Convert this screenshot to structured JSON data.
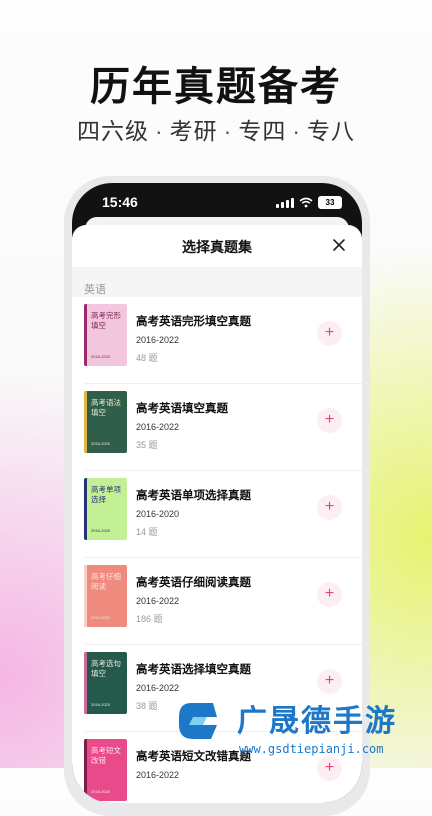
{
  "promo": {
    "headline": "历年真题备考",
    "subtitle_items": [
      "四六级",
      "考研",
      "专四",
      "专八"
    ],
    "separator": "·"
  },
  "phone": {
    "status_time": "15:46",
    "battery": "33",
    "sheet": {
      "title": "选择真题集",
      "section_label": "英语",
      "items": [
        {
          "name": "高考英语完形填空真题",
          "years": "2016-2022",
          "count": "48 题",
          "cover_title": "高考完形填空",
          "cover_year": "2016-2020",
          "cover_bg": "#f2c7dd",
          "cover_spine": "#9a2a6b",
          "cover_text": "#7b1f55"
        },
        {
          "name": "高考英语填空真题",
          "years": "2016-2022",
          "count": "35 题",
          "cover_title": "高考语法填空",
          "cover_year": "2016-2020",
          "cover_bg": "#2f5f4b",
          "cover_spine": "#e0b545",
          "cover_text": "#e8f0d0"
        },
        {
          "name": "高考英语单项选择真题",
          "years": "2016-2020",
          "count": "14 题",
          "cover_title": "高考单项选择",
          "cover_year": "2016-2020",
          "cover_bg": "#c3ef95",
          "cover_spine": "#2b2f7a",
          "cover_text": "#2b2f7a"
        },
        {
          "name": "高考英语仔细阅读真题",
          "years": "2016-2022",
          "count": "186 题",
          "cover_title": "高考仔细阅读",
          "cover_year": "2016-2020",
          "cover_bg": "#ef8a7e",
          "cover_spine": "#f6d1c8",
          "cover_text": "#fbe3dc"
        },
        {
          "name": "高考英语选择填空真题",
          "years": "2016-2022",
          "count": "38 题",
          "cover_title": "高考选句填空",
          "cover_year": "2016-2020",
          "cover_bg": "#24594c",
          "cover_spine": "#c86a9a",
          "cover_text": "#e6efe0"
        },
        {
          "name": "高考英语短文改错真题",
          "years": "2016-2022",
          "count": "",
          "cover_title": "高考短文改错",
          "cover_year": "2016-2020",
          "cover_bg": "#e94a8a",
          "cover_spine": "#7a1f4a",
          "cover_text": "#fde7ef"
        }
      ]
    }
  },
  "watermark": {
    "name": "广晟德手游",
    "url": "www.gsdtiepianji.com",
    "color": "#1e78c8"
  }
}
